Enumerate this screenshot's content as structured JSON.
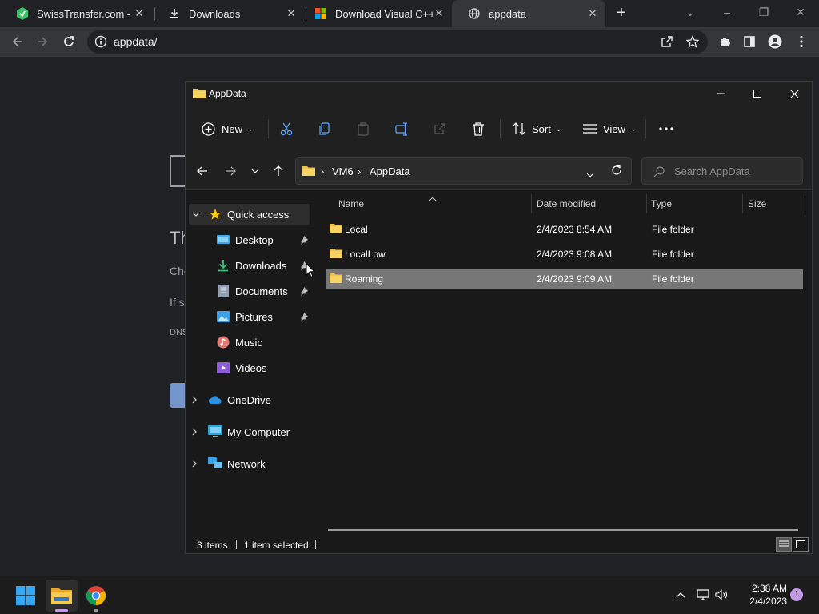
{
  "browser": {
    "tabs": [
      {
        "title": "SwissTransfer.com - Se",
        "icon": "swisstransfer-icon"
      },
      {
        "title": "Downloads",
        "icon": "download-icon"
      },
      {
        "title": "Download Visual C++ ",
        "icon": "microsoft-logo-icon"
      },
      {
        "title": "appdata",
        "icon": "globe-icon",
        "active": true
      }
    ],
    "url": "appdata/"
  },
  "page_behind": {
    "fragments": [
      "Th",
      "Che",
      "If s",
      "DNS"
    ]
  },
  "explorer": {
    "title": "AppData",
    "commands": {
      "new": "New",
      "sort": "Sort",
      "view": "View"
    },
    "breadcrumb": [
      "VM6",
      "AppData"
    ],
    "search_placeholder": "Search AppData",
    "nav": {
      "quick_access": "Quick access",
      "pinned": [
        {
          "label": "Desktop",
          "icon": "desktop-icon",
          "pinned": true
        },
        {
          "label": "Downloads",
          "icon": "downloads-arrow-icon",
          "pinned": true
        },
        {
          "label": "Documents",
          "icon": "documents-icon",
          "pinned": true
        },
        {
          "label": "Pictures",
          "icon": "pictures-icon",
          "pinned": true
        },
        {
          "label": "Music",
          "icon": "music-icon",
          "pinned": false
        },
        {
          "label": "Videos",
          "icon": "videos-icon",
          "pinned": false
        }
      ],
      "roots": [
        {
          "label": "OneDrive",
          "icon": "onedrive-cloud-icon"
        },
        {
          "label": "My Computer",
          "icon": "computer-icon"
        },
        {
          "label": "Network",
          "icon": "network-icon"
        }
      ]
    },
    "columns": {
      "name": "Name",
      "date": "Date modified",
      "type": "Type",
      "size": "Size"
    },
    "files": [
      {
        "name": "Local",
        "date": "2/4/2023 8:54 AM",
        "type": "File folder",
        "size": "",
        "selected": false
      },
      {
        "name": "LocalLow",
        "date": "2/4/2023 9:08 AM",
        "type": "File folder",
        "size": "",
        "selected": false
      },
      {
        "name": "Roaming",
        "date": "2/4/2023 9:09 AM",
        "type": "File folder",
        "size": "",
        "selected": true
      }
    ],
    "status": {
      "items": "3 items",
      "selected": "1 item selected"
    }
  },
  "taskbar": {
    "time": "2:38 AM",
    "date": "2/4/2023",
    "notifications": "1"
  },
  "colors": {
    "folder": "#f0c24b",
    "selection": "#777777",
    "chrome_tab_active": "#35363a"
  }
}
